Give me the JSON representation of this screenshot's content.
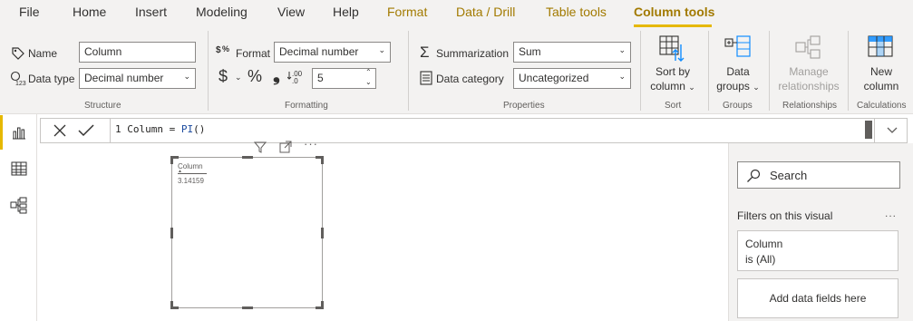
{
  "menu": {
    "tabs": [
      "File",
      "Home",
      "Insert",
      "Modeling",
      "View",
      "Help",
      "Format",
      "Data / Drill",
      "Table tools",
      "Column tools"
    ],
    "active_tab": "Column tools"
  },
  "ribbon": {
    "structure": {
      "name_label": "Name",
      "name_value": "Column",
      "datatype_label": "Data type",
      "datatype_value": "Decimal number",
      "group_label": "Structure"
    },
    "formatting": {
      "format_label": "Format",
      "format_value": "Decimal number",
      "currency_symbol": "$",
      "percent_symbol": "%",
      "comma_symbol": "❟",
      "decimals_value": "5",
      "group_label": "Formatting"
    },
    "properties": {
      "summarization_label": "Summarization",
      "summarization_value": "Sum",
      "category_label": "Data category",
      "category_value": "Uncategorized",
      "group_label": "Properties"
    },
    "sort": {
      "button_line1": "Sort by",
      "button_line2": "column",
      "group_label": "Sort"
    },
    "groups": {
      "button_line1": "Data",
      "button_line2": "groups",
      "group_label": "Groups"
    },
    "relationships": {
      "button_line1": "Manage",
      "button_line2": "relationships",
      "group_label": "Relationships"
    },
    "calculations": {
      "button_line1": "New",
      "button_line2": "column",
      "group_label": "Calculations"
    }
  },
  "formula": {
    "line_number": "1",
    "text_before": " Column = ",
    "function": "PI",
    "text_after": "()"
  },
  "visual": {
    "column_header": "Column",
    "value": "3.14159"
  },
  "filters_pane": {
    "search_placeholder": "Search",
    "section_title": "Filters on this visual",
    "more": "...",
    "card_field": "Column",
    "card_state": "is (All)",
    "add_data_label": "Add data fields here"
  }
}
